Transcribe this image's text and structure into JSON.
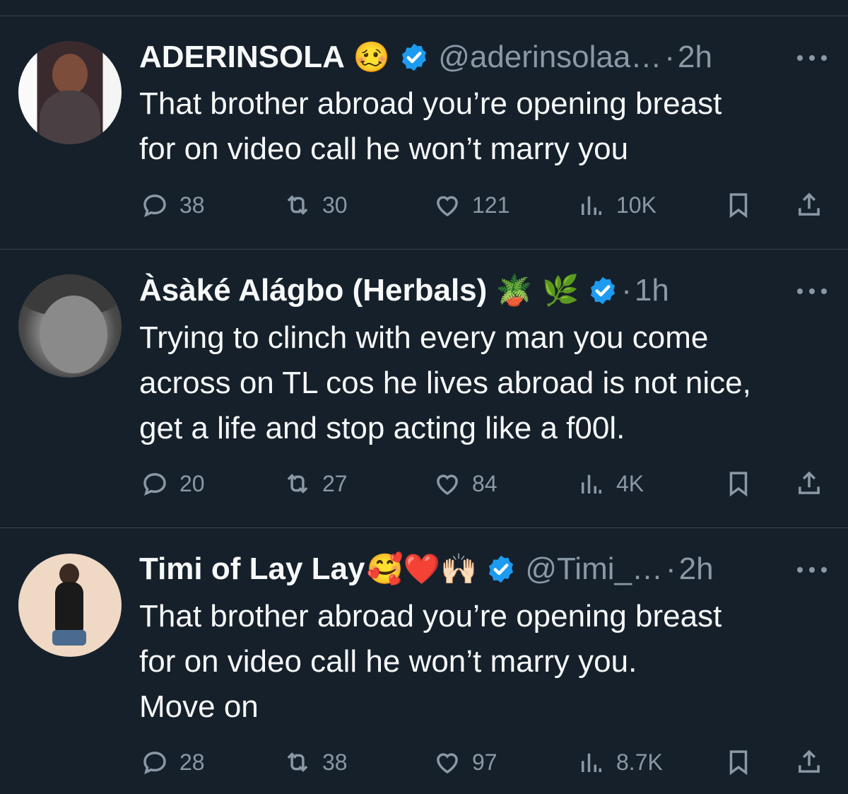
{
  "tweets": [
    {
      "name": "ADERINSOLA",
      "emojis": "🥴",
      "handle": "@aderinsolaa…",
      "dot": "·",
      "time": "2h",
      "lines": [
        "That brother abroad you’re opening breast",
        "for on video call he won’t marry you"
      ],
      "replies": "38",
      "retweets": "30",
      "likes": "121",
      "views": "10K"
    },
    {
      "name": "Àsàké Alágbo (Herbals)",
      "emojis": "🪴 🌿",
      "handle": "",
      "dot": "·",
      "time": "1h",
      "lines": [
        "Trying to clinch with every man you come",
        "across on TL cos he lives abroad is not nice,",
        "get a life and stop acting like a f00l."
      ],
      "replies": "20",
      "retweets": "27",
      "likes": "84",
      "views": "4K"
    },
    {
      "name": "Timi of Lay Lay",
      "emojis": "🥰❤️🙌🏻",
      "handle": "@Timi_…",
      "dot": "·",
      "time": "2h",
      "lines": [
        "That brother abroad you’re opening breast",
        "for on video call he won’t marry you.",
        "Move on"
      ],
      "replies": "28",
      "retweets": "38",
      "likes": "97",
      "views": "8.7K"
    }
  ],
  "icons": {
    "reply": "reply-icon",
    "retweet": "retweet-icon",
    "like": "heart-icon",
    "views": "views-icon",
    "bookmark": "bookmark-icon",
    "share": "share-icon",
    "verified": "verified-badge-icon",
    "more": "more-icon"
  },
  "colors": {
    "background": "#15202b",
    "text": "#f7f9f9",
    "muted": "#8b98a5",
    "verified": "#1d9bf0",
    "divider": "#38444d"
  }
}
